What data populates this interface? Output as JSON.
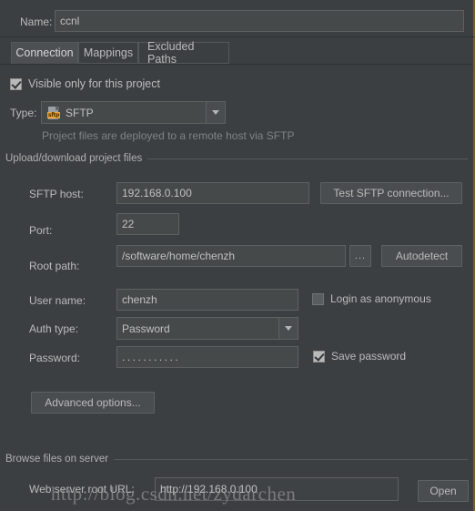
{
  "dialog": {
    "name_label": "Name:",
    "name_value": "ccnl"
  },
  "tabs": [
    {
      "label": "Connection",
      "selected": true
    },
    {
      "label": "Mappings",
      "selected": false
    },
    {
      "label": "Excluded Paths",
      "selected": false
    }
  ],
  "connection": {
    "visible_only_checkbox": {
      "label": "Visible only for this project",
      "checked": true
    },
    "type_label": "Type:",
    "type_value": "SFTP",
    "type_icon": "sftp-file-icon",
    "type_icon_text": "sftp",
    "type_hint": "Project files are deployed to a remote host via SFTP",
    "upload_group_title": "Upload/download project files",
    "sftp_host_label": "SFTP host:",
    "sftp_host_value": "192.168.0.100",
    "test_connection_button": "Test SFTP connection...",
    "port_label": "Port:",
    "port_value": "22",
    "root_path_label": "Root path:",
    "root_path_value": "/software/home/chenzh",
    "browse_button": "...",
    "autodetect_button": "Autodetect",
    "user_name_label": "User name:",
    "user_name_value": "chenzh",
    "login_anonymous_checkbox": {
      "label": "Login as anonymous",
      "checked": false
    },
    "auth_type_label": "Auth type:",
    "auth_type_value": "Password",
    "password_label": "Password:",
    "password_value": "...........",
    "save_password_checkbox": {
      "label": "Save password",
      "checked": true
    },
    "advanced_options_button": "Advanced options...",
    "browse_group_title": "Browse files on server",
    "web_root_label": "Web server root URL:",
    "web_root_value": "http://192.168.0.100",
    "open_button": "Open"
  },
  "watermark": "http://blog.csdn.net/zydarchen",
  "colors": {
    "background": "#3c3f41",
    "field_bg": "#45494a",
    "text": "#bbbbbb",
    "hint_text": "#7f8386",
    "accent_icon": "#e8a33d",
    "right_border": "#7a5c33"
  }
}
